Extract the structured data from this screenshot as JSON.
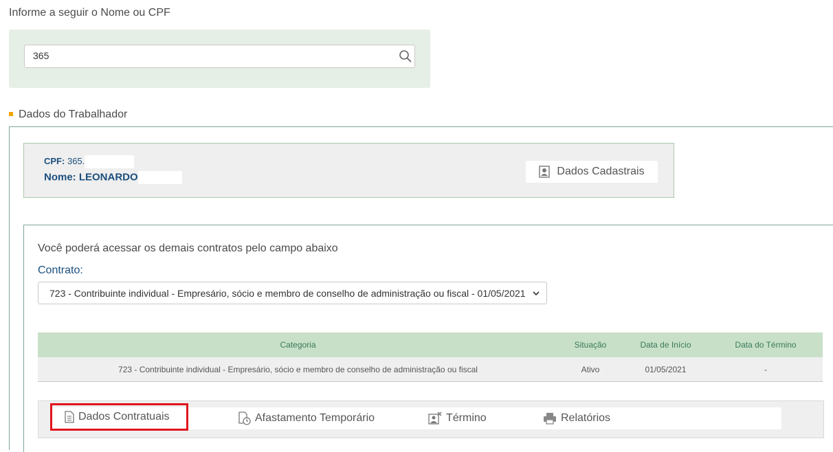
{
  "search": {
    "prompt": "Informe a seguir o Nome ou CPF",
    "value": "365"
  },
  "worker": {
    "section_title": "Dados do Trabalhador",
    "cpf_label": "CPF:",
    "cpf_value": "365.",
    "nome_label": "Nome:",
    "nome_value": "LEONARDO",
    "dados_cadastrais_button": "Dados Cadastrais"
  },
  "contract": {
    "info_text": "Você poderá acessar os demais contratos pelo campo abaixo",
    "label": "Contrato:",
    "selected": "723 - Contribuinte individual - Empresário, sócio e membro de conselho de administração ou fiscal - 01/05/2021"
  },
  "table": {
    "headers": [
      "Categoria",
      "Situação",
      "Data de Início",
      "Data do Término"
    ],
    "rows": [
      [
        "723 - Contribuinte individual - Empresário, sócio e membro de conselho de administração ou fiscal",
        "Ativo",
        "01/05/2021",
        "-"
      ]
    ]
  },
  "tabs": {
    "dados_contratuais": "Dados Contratuais",
    "afastamento": "Afastamento Temporário",
    "termino": "Término",
    "relatorios": "Relatórios"
  },
  "colors": {
    "accent_green_bg": "#e6efe6",
    "header_green": "#c8e0c8",
    "highlight_red": "#e0141e",
    "link_blue": "#1b4f7d",
    "bullet_orange": "#f0a400"
  }
}
